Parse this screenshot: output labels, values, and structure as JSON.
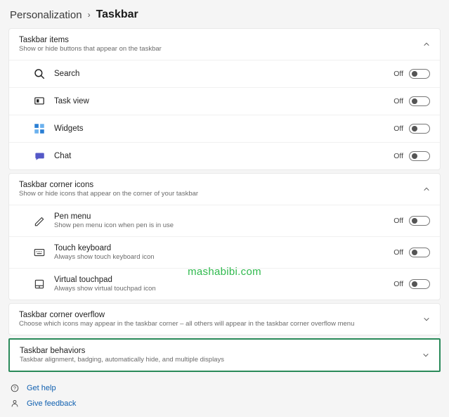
{
  "breadcrumb": {
    "parent": "Personalization",
    "current": "Taskbar"
  },
  "sections": {
    "items": {
      "title": "Taskbar items",
      "subtitle": "Show or hide buttons that appear on the taskbar",
      "rows": [
        {
          "label": "Search",
          "state": "Off"
        },
        {
          "label": "Task view",
          "state": "Off"
        },
        {
          "label": "Widgets",
          "state": "Off"
        },
        {
          "label": "Chat",
          "state": "Off"
        }
      ]
    },
    "corner_icons": {
      "title": "Taskbar corner icons",
      "subtitle": "Show or hide icons that appear on the corner of your taskbar",
      "rows": [
        {
          "label": "Pen menu",
          "sublabel": "Show pen menu icon when pen is in use",
          "state": "Off"
        },
        {
          "label": "Touch keyboard",
          "sublabel": "Always show touch keyboard icon",
          "state": "Off"
        },
        {
          "label": "Virtual touchpad",
          "sublabel": "Always show virtual touchpad icon",
          "state": "Off"
        }
      ]
    },
    "overflow": {
      "title": "Taskbar corner overflow",
      "subtitle": "Choose which icons may appear in the taskbar corner – all others will appear in the taskbar corner overflow menu"
    },
    "behaviors": {
      "title": "Taskbar behaviors",
      "subtitle": "Taskbar alignment, badging, automatically hide, and multiple displays"
    }
  },
  "footer": {
    "help": "Get help",
    "feedback": "Give feedback"
  },
  "watermark": "mashabibi.com"
}
